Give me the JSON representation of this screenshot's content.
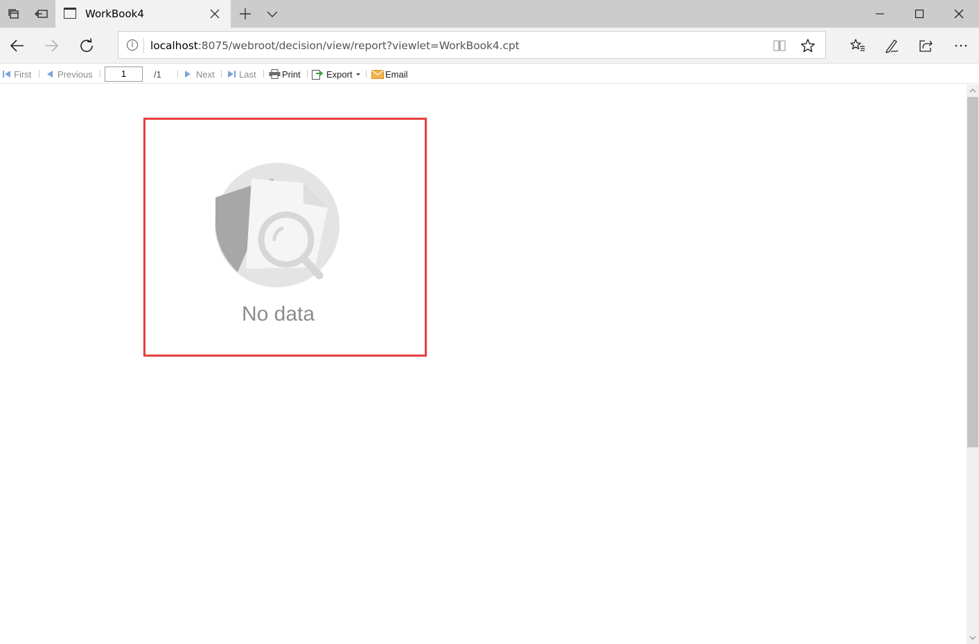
{
  "tab": {
    "title": "WorkBook4"
  },
  "address": {
    "host": "localhost",
    "path": ":8075/webroot/decision/view/report?viewlet=WorkBook4.cpt"
  },
  "toolbar": {
    "first": "First",
    "previous": "Previous",
    "page_value": "1",
    "page_total": "/1",
    "next": "Next",
    "last": "Last",
    "print": "Print",
    "export": "Export",
    "email": "Email"
  },
  "content": {
    "empty_message": "No data"
  },
  "colors": {
    "highlight_border": "#e8413f",
    "chrome": "#cccccc",
    "navbar": "#f2f2f2"
  },
  "scrollbar": {
    "position_fraction": 0.0
  }
}
